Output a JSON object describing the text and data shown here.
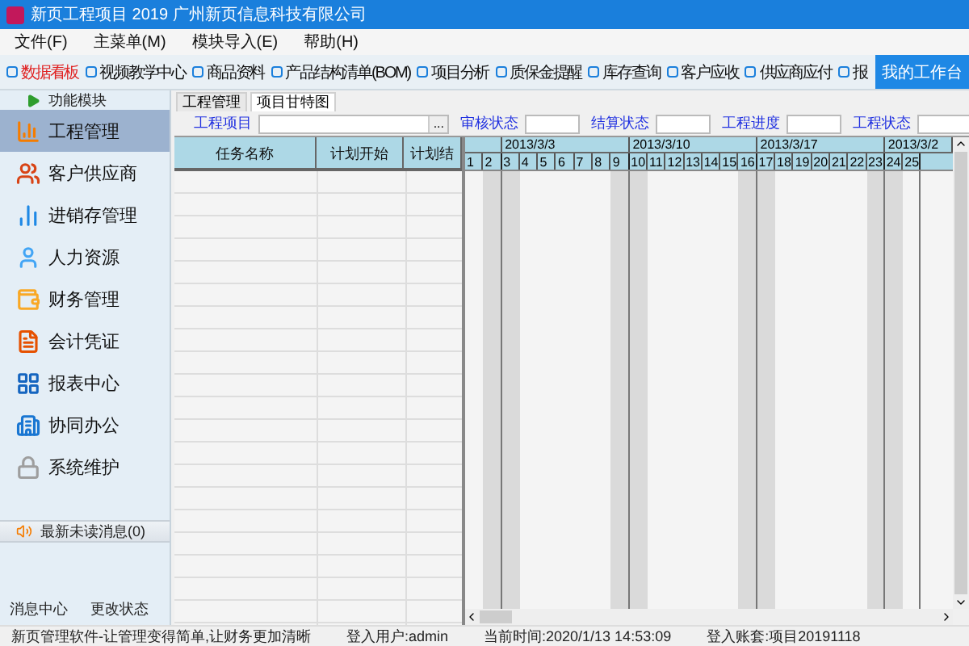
{
  "window": {
    "title": "新页工程项目 2019 广州新页信息科技有限公司"
  },
  "menu": [
    "文件(F)",
    "主菜单(M)",
    "模块导入(E)",
    "帮助(H)"
  ],
  "toolbar": {
    "items": [
      {
        "label": "数据看板",
        "selected": true
      },
      {
        "label": "视频教学中心",
        "selected": false
      },
      {
        "label": "商品资料",
        "selected": false
      },
      {
        "label": "产品结构清单(BOM)",
        "selected": false
      },
      {
        "label": "项目分析",
        "selected": false
      },
      {
        "label": "质保金提醒",
        "selected": false
      },
      {
        "label": "库存查询",
        "selected": false
      },
      {
        "label": "客户应收",
        "selected": false
      },
      {
        "label": "供应商应付",
        "selected": false
      },
      {
        "label": "报",
        "selected": false
      }
    ],
    "workbench_button": "我的工作台"
  },
  "sidebar": {
    "header": "功能模块",
    "items": [
      {
        "label": "工程管理",
        "selected": true
      },
      {
        "label": "客户供应商",
        "selected": false
      },
      {
        "label": "进销存管理",
        "selected": false
      },
      {
        "label": "人力资源",
        "selected": false
      },
      {
        "label": "财务管理",
        "selected": false
      },
      {
        "label": "会计凭证",
        "selected": false
      },
      {
        "label": "报表中心",
        "selected": false
      },
      {
        "label": "协同办公",
        "selected": false
      },
      {
        "label": "系统维护",
        "selected": false
      }
    ],
    "messages": "最新未读消息(0)",
    "footer_links": [
      "消息中心",
      "更改状态"
    ]
  },
  "tabs": [
    {
      "label": "工程管理",
      "selected": false
    },
    {
      "label": "项目甘特图",
      "selected": true
    }
  ],
  "filters": [
    {
      "label": "工程项目",
      "kind": "picker",
      "button": "..."
    },
    {
      "label": "审核状态",
      "kind": "text"
    },
    {
      "label": "结算状态",
      "kind": "text"
    },
    {
      "label": "工程进度",
      "kind": "text"
    },
    {
      "label": "工程状态",
      "kind": "text"
    }
  ],
  "table": {
    "columns": [
      "任务名称",
      "计划开始",
      "计划结"
    ]
  },
  "gantt": {
    "weeks": [
      {
        "days": [
          {
            "label": "1",
            "shaded": false
          },
          {
            "label": "2",
            "shaded": true
          }
        ]
      },
      {
        "label": "2013/3/3",
        "days": [
          {
            "label": "3",
            "shaded": true
          },
          {
            "label": "4",
            "shaded": false
          },
          {
            "label": "5",
            "shaded": false
          },
          {
            "label": "6",
            "shaded": false
          },
          {
            "label": "7",
            "shaded": false
          },
          {
            "label": "8",
            "shaded": false
          },
          {
            "label": "9",
            "shaded": true
          }
        ]
      },
      {
        "label": "2013/3/10",
        "days": [
          {
            "label": "10",
            "shaded": true
          },
          {
            "label": "11",
            "shaded": false
          },
          {
            "label": "12",
            "shaded": false
          },
          {
            "label": "13",
            "shaded": false
          },
          {
            "label": "14",
            "shaded": false
          },
          {
            "label": "15",
            "shaded": false
          },
          {
            "label": "16",
            "shaded": true
          }
        ]
      },
      {
        "label": "2013/3/17",
        "days": [
          {
            "label": "17",
            "shaded": true
          },
          {
            "label": "18",
            "shaded": false
          },
          {
            "label": "19",
            "shaded": false
          },
          {
            "label": "20",
            "shaded": false
          },
          {
            "label": "21",
            "shaded": false
          },
          {
            "label": "22",
            "shaded": false
          },
          {
            "label": "23",
            "shaded": true
          }
        ]
      },
      {
        "label": "2013/3/2",
        "days": [
          {
            "label": "24",
            "shaded": true
          },
          {
            "label": "25",
            "shaded": false
          }
        ]
      }
    ]
  },
  "status_bar": [
    "新页管理软件-让管理变得简单,让财务更加清晰",
    "登入用户:admin",
    "当前时间:2020/1/13 14:53:09",
    "登入账套:项目20191118"
  ]
}
